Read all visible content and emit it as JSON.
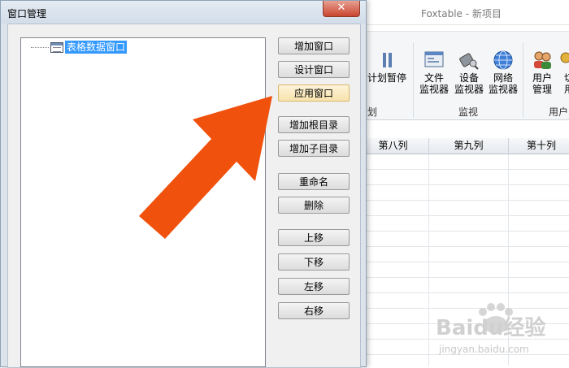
{
  "app": {
    "title": "Foxtable - 新项目",
    "ribbon": {
      "partial_group_label": "划",
      "schedule_pause": "计划暂停",
      "monitor_group": {
        "label": "监视",
        "items": [
          {
            "line1": "文件",
            "line2": "监视器",
            "icon": "file-monitor-icon"
          },
          {
            "line1": "设备",
            "line2": "监视器",
            "icon": "device-monitor-icon"
          },
          {
            "line1": "网络",
            "line2": "监视器",
            "icon": "network-monitor-icon"
          }
        ]
      },
      "user_group": {
        "label": "用户",
        "items": [
          {
            "line1": "用户",
            "line2": "管理",
            "icon": "users-icon"
          },
          {
            "line1": "切",
            "line2": "用",
            "icon": "key-icon"
          }
        ]
      }
    },
    "sheet": {
      "columns": [
        "第八列",
        "第九列",
        "第十列"
      ]
    }
  },
  "dialog": {
    "title": "窗口管理",
    "close_glyph": "✕",
    "tree": {
      "node_label": "表格数据窗口"
    },
    "buttons": {
      "add_window": "增加窗口",
      "design_window": "设计窗口",
      "apply_window": "应用窗口",
      "add_root_dir": "增加根目录",
      "add_sub_dir": "增加子目录",
      "rename": "重命名",
      "delete": "删除",
      "move_up": "上移",
      "move_down": "下移",
      "move_left": "左移",
      "move_right": "右移"
    }
  },
  "overlay": {
    "pointer_color": "#f0520e",
    "highlighted_button": "apply_window"
  },
  "watermark": {
    "brand": "Baidu经验",
    "url": "jingyan.baidu.com"
  }
}
